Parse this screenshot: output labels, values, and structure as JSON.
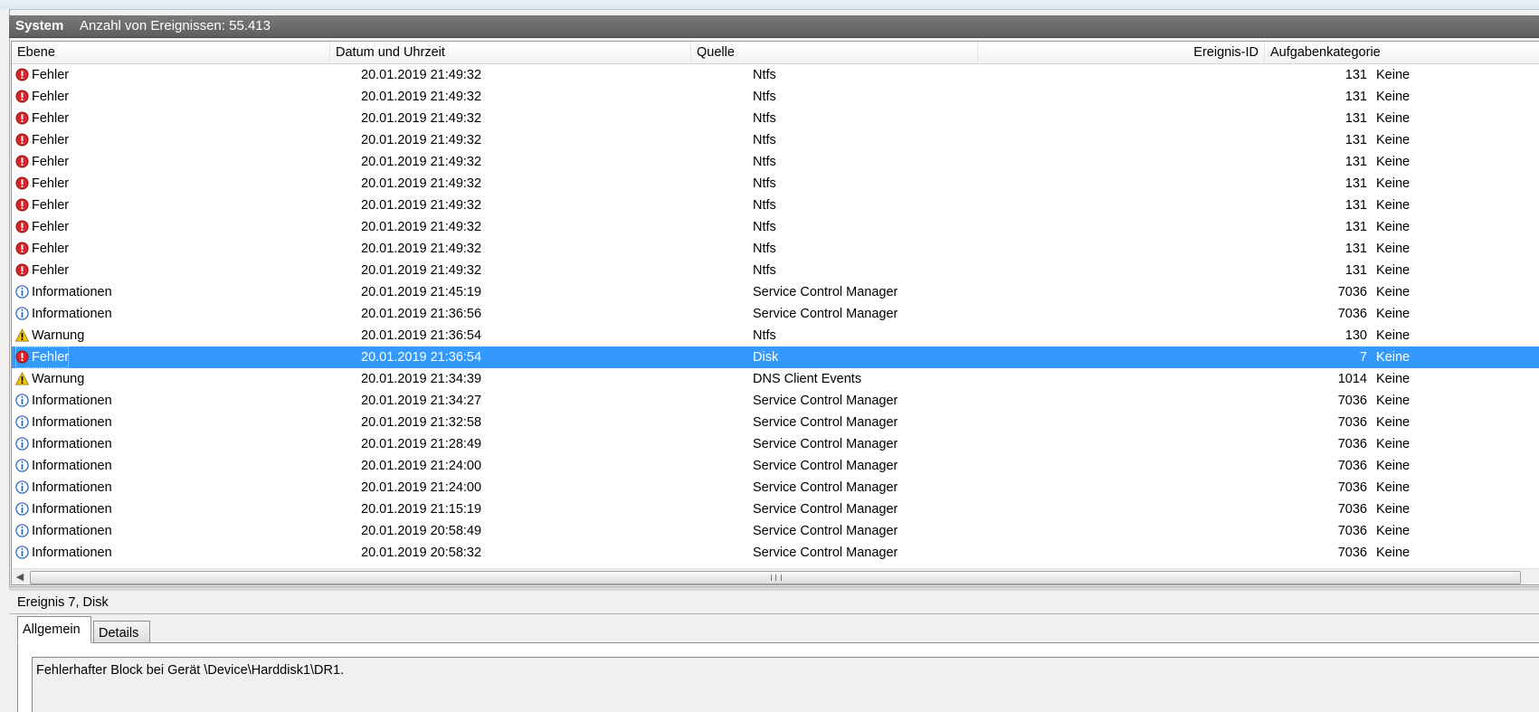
{
  "title_bar": {
    "log_name": "System",
    "event_count": "Anzahl von Ereignissen: 55.413"
  },
  "columns": [
    "Ebene",
    "Datum und Uhrzeit",
    "Quelle",
    "Ereignis-ID",
    "Aufgabenkategorie"
  ],
  "icons": {
    "error": "error-icon",
    "info": "info-icon",
    "warning": "warning-icon"
  },
  "colors": {
    "selection": "#3399ff",
    "error": "#d9262a",
    "info": "#2a5fb5",
    "warning": "#f4c20d",
    "title_bar": "#6b6b6b"
  },
  "events": [
    {
      "icon": "error",
      "level": "Fehler",
      "datetime": "20.01.2019 21:49:32",
      "source": "Ntfs",
      "event_id": "131",
      "category": "Keine",
      "selected": false
    },
    {
      "icon": "error",
      "level": "Fehler",
      "datetime": "20.01.2019 21:49:32",
      "source": "Ntfs",
      "event_id": "131",
      "category": "Keine",
      "selected": false
    },
    {
      "icon": "error",
      "level": "Fehler",
      "datetime": "20.01.2019 21:49:32",
      "source": "Ntfs",
      "event_id": "131",
      "category": "Keine",
      "selected": false
    },
    {
      "icon": "error",
      "level": "Fehler",
      "datetime": "20.01.2019 21:49:32",
      "source": "Ntfs",
      "event_id": "131",
      "category": "Keine",
      "selected": false
    },
    {
      "icon": "error",
      "level": "Fehler",
      "datetime": "20.01.2019 21:49:32",
      "source": "Ntfs",
      "event_id": "131",
      "category": "Keine",
      "selected": false
    },
    {
      "icon": "error",
      "level": "Fehler",
      "datetime": "20.01.2019 21:49:32",
      "source": "Ntfs",
      "event_id": "131",
      "category": "Keine",
      "selected": false
    },
    {
      "icon": "error",
      "level": "Fehler",
      "datetime": "20.01.2019 21:49:32",
      "source": "Ntfs",
      "event_id": "131",
      "category": "Keine",
      "selected": false
    },
    {
      "icon": "error",
      "level": "Fehler",
      "datetime": "20.01.2019 21:49:32",
      "source": "Ntfs",
      "event_id": "131",
      "category": "Keine",
      "selected": false
    },
    {
      "icon": "error",
      "level": "Fehler",
      "datetime": "20.01.2019 21:49:32",
      "source": "Ntfs",
      "event_id": "131",
      "category": "Keine",
      "selected": false
    },
    {
      "icon": "error",
      "level": "Fehler",
      "datetime": "20.01.2019 21:49:32",
      "source": "Ntfs",
      "event_id": "131",
      "category": "Keine",
      "selected": false
    },
    {
      "icon": "info",
      "level": "Informationen",
      "datetime": "20.01.2019 21:45:19",
      "source": "Service Control Manager",
      "event_id": "7036",
      "category": "Keine",
      "selected": false
    },
    {
      "icon": "info",
      "level": "Informationen",
      "datetime": "20.01.2019 21:36:56",
      "source": "Service Control Manager",
      "event_id": "7036",
      "category": "Keine",
      "selected": false
    },
    {
      "icon": "warning",
      "level": "Warnung",
      "datetime": "20.01.2019 21:36:54",
      "source": "Ntfs",
      "event_id": "130",
      "category": "Keine",
      "selected": false
    },
    {
      "icon": "error",
      "level": "Fehler",
      "datetime": "20.01.2019 21:36:54",
      "source": "Disk",
      "event_id": "7",
      "category": "Keine",
      "selected": true
    },
    {
      "icon": "warning",
      "level": "Warnung",
      "datetime": "20.01.2019 21:34:39",
      "source": "DNS Client Events",
      "event_id": "1014",
      "category": "Keine",
      "selected": false
    },
    {
      "icon": "info",
      "level": "Informationen",
      "datetime": "20.01.2019 21:34:27",
      "source": "Service Control Manager",
      "event_id": "7036",
      "category": "Keine",
      "selected": false
    },
    {
      "icon": "info",
      "level": "Informationen",
      "datetime": "20.01.2019 21:32:58",
      "source": "Service Control Manager",
      "event_id": "7036",
      "category": "Keine",
      "selected": false
    },
    {
      "icon": "info",
      "level": "Informationen",
      "datetime": "20.01.2019 21:28:49",
      "source": "Service Control Manager",
      "event_id": "7036",
      "category": "Keine",
      "selected": false
    },
    {
      "icon": "info",
      "level": "Informationen",
      "datetime": "20.01.2019 21:24:00",
      "source": "Service Control Manager",
      "event_id": "7036",
      "category": "Keine",
      "selected": false
    },
    {
      "icon": "info",
      "level": "Informationen",
      "datetime": "20.01.2019 21:24:00",
      "source": "Service Control Manager",
      "event_id": "7036",
      "category": "Keine",
      "selected": false
    },
    {
      "icon": "info",
      "level": "Informationen",
      "datetime": "20.01.2019 21:15:19",
      "source": "Service Control Manager",
      "event_id": "7036",
      "category": "Keine",
      "selected": false
    },
    {
      "icon": "info",
      "level": "Informationen",
      "datetime": "20.01.2019 20:58:49",
      "source": "Service Control Manager",
      "event_id": "7036",
      "category": "Keine",
      "selected": false
    },
    {
      "icon": "info",
      "level": "Informationen",
      "datetime": "20.01.2019 20:58:32",
      "source": "Service Control Manager",
      "event_id": "7036",
      "category": "Keine",
      "selected": false
    }
  ],
  "detail": {
    "title": "Ereignis 7, Disk",
    "tabs": [
      "Allgemein",
      "Details"
    ],
    "active_tab": "Allgemein",
    "description": "Fehlerhafter Block bei Gerät \\Device\\Harddisk1\\DR1."
  }
}
